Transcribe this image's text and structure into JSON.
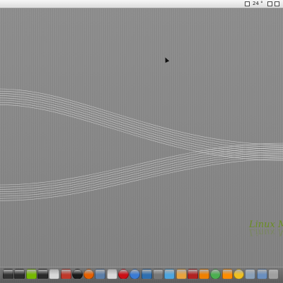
{
  "desktop": {
    "wallpaper_brand": "Linux Mint",
    "logo_visible_text": "Linux Mi",
    "logo_color": "#6b8e23"
  },
  "top_panel": {
    "clock": "24 °F"
  },
  "dock": {
    "icons": [
      {
        "name": "power-icon",
        "color": "#333333"
      },
      {
        "name": "terminal-icon",
        "color": "#2b2b2b"
      },
      {
        "name": "nvidia-icon",
        "color": "#76b900"
      },
      {
        "name": "monitor-icon",
        "color": "#2a2a2a"
      },
      {
        "name": "drive-icon",
        "color": "#d8d8d8"
      },
      {
        "name": "photo-icon",
        "color": "#c0392b"
      },
      {
        "name": "display-icon",
        "color": "#1a1a1a"
      },
      {
        "name": "firefox-icon",
        "color": "#e66000"
      },
      {
        "name": "mail-icon",
        "color": "#5b7ea8"
      },
      {
        "name": "chat-icon",
        "color": "#d9d9d9"
      },
      {
        "name": "opera-icon",
        "color": "#cc0f16"
      },
      {
        "name": "chrome-icon",
        "color": "#3a7bd5"
      },
      {
        "name": "network-icon",
        "color": "#2f6fb0"
      },
      {
        "name": "gear-icon",
        "color": "#777777"
      },
      {
        "name": "bird-icon",
        "color": "#4da6e0"
      },
      {
        "name": "photos-icon",
        "color": "#e8a33d"
      },
      {
        "name": "pdf-icon",
        "color": "#b22222"
      },
      {
        "name": "vlc-icon",
        "color": "#f08000"
      },
      {
        "name": "play-icon",
        "color": "#4caf50"
      },
      {
        "name": "cone-icon",
        "color": "#ff8c00"
      },
      {
        "name": "smile-icon",
        "color": "#f0c020"
      },
      {
        "name": "files-icon",
        "color": "#8aa0b8"
      },
      {
        "name": "window-icon",
        "color": "#6a8fbf"
      },
      {
        "name": "trash-icon",
        "color": "#a0a0a0"
      }
    ]
  }
}
